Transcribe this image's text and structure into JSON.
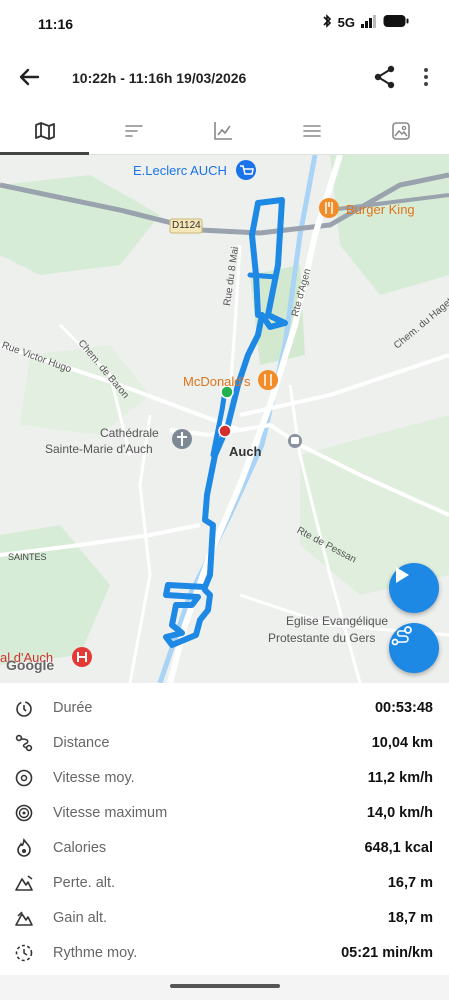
{
  "status_bar": {
    "time": "11:16",
    "network": "5G"
  },
  "header": {
    "title": "10:22h - 11:16h  19/03/2026"
  },
  "tabs": [
    {
      "name": "map",
      "icon": "map-icon",
      "active": true
    },
    {
      "name": "sort",
      "icon": "sort-icon",
      "active": false
    },
    {
      "name": "chart",
      "icon": "chart-icon",
      "active": false
    },
    {
      "name": "list",
      "icon": "list-icon",
      "active": false
    },
    {
      "name": "photo",
      "icon": "photo-icon",
      "active": false
    }
  ],
  "map": {
    "labels": {
      "leclerc": "E.Leclerc AUCH",
      "burger_king": "Burger King",
      "d1124": "D1124",
      "rue_du_8_mai": "Rue du 8 Mai",
      "rte_dagen": "Rte d'Agen",
      "chem_du_haget": "Chem. du Haget",
      "rue_victor_hugo": "Rue Victor Hugo",
      "chem_de_baron": "Chem. de Baron",
      "mcdonalds": "McDonald's",
      "cathedrale_1": "Cathédrale",
      "cathedrale_2": "Sainte-Marie d'Auch",
      "auch": "Auch",
      "saintes": "SAINTES",
      "rte_de_pessan": "Rte de Pessan",
      "eglise_1": "Eglise Evangélique",
      "eglise_2": "Protestante du Gers",
      "hospital_partial": "al d'Auch",
      "google": "Google"
    },
    "route_color": "#1e88e5",
    "start_color": "#22b14c",
    "end_color": "#d32f2f"
  },
  "stats": [
    {
      "icon": "timer-icon",
      "label": "Durée",
      "value": "00:53:48"
    },
    {
      "icon": "route-icon",
      "label": "Distance",
      "value": "10,04 km"
    },
    {
      "icon": "speed-avg-icon",
      "label": "Vitesse moy.",
      "value": "11,2 km/h"
    },
    {
      "icon": "speed-max-icon",
      "label": "Vitesse maximum",
      "value": "14,0 km/h"
    },
    {
      "icon": "calories-icon",
      "label": "Calories",
      "value": "648,1 kcal"
    },
    {
      "icon": "elevation-loss-icon",
      "label": "Perte. alt.",
      "value": "16,7 m"
    },
    {
      "icon": "elevation-gain-icon",
      "label": "Gain alt.",
      "value": "18,7 m"
    },
    {
      "icon": "pace-icon",
      "label": "Rythme moy.",
      "value": "05:21 min/km"
    }
  ]
}
